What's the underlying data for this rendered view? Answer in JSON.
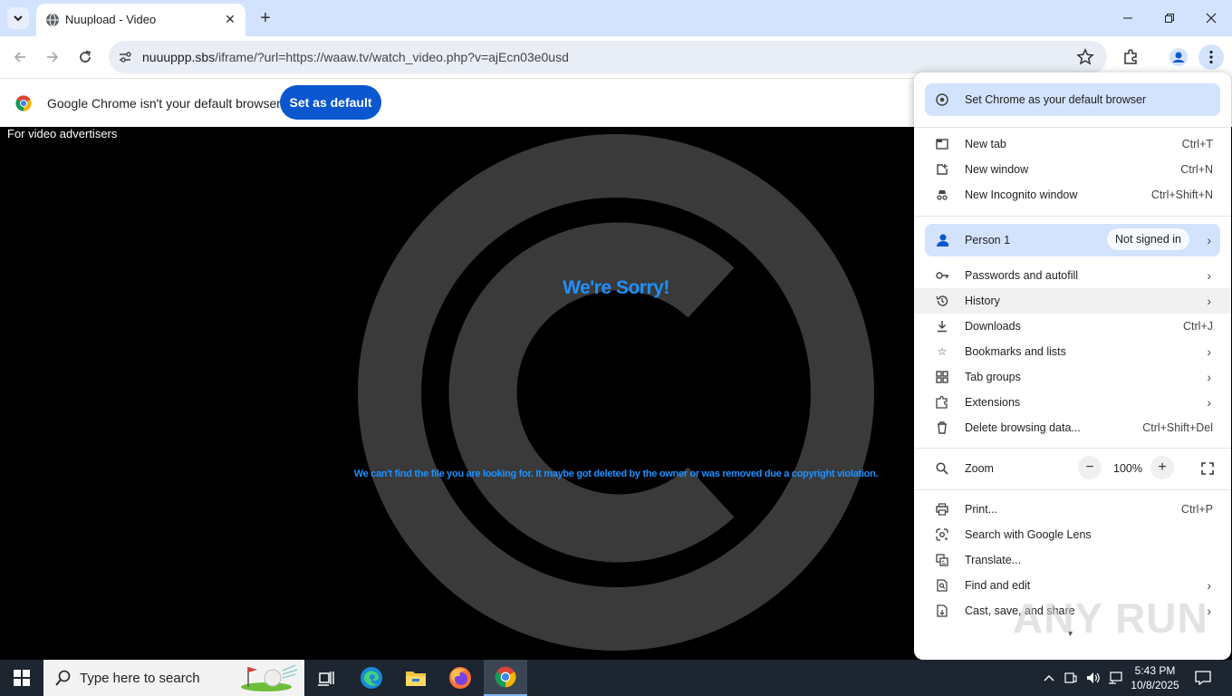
{
  "browser": {
    "tab_title": "Nuupload - Video",
    "url_domain": "nuuuppp.sbs",
    "url_path": "/iframe/?url=https://waaw.tv/watch_video.php?v=ajEcn03e0usd"
  },
  "infobar": {
    "message": "Google Chrome isn't your default browser",
    "button_label": "Set as default"
  },
  "page": {
    "advertisers_text": "For video advertisers",
    "heading": "We're Sorry!",
    "message": "We can't find the file you are looking for. It maybe got deleted by the owner or was removed due a copyright violation."
  },
  "menu": {
    "set_default": "Set Chrome as your default browser",
    "new_tab": {
      "label": "New tab",
      "shortcut": "Ctrl+T"
    },
    "new_window": {
      "label": "New window",
      "shortcut": "Ctrl+N"
    },
    "new_incognito": {
      "label": "New Incognito window",
      "shortcut": "Ctrl+Shift+N"
    },
    "profile": {
      "label": "Person 1",
      "status": "Not signed in"
    },
    "passwords": {
      "label": "Passwords and autofill"
    },
    "history": {
      "label": "History"
    },
    "downloads": {
      "label": "Downloads",
      "shortcut": "Ctrl+J"
    },
    "bookmarks": {
      "label": "Bookmarks and lists"
    },
    "tab_groups": {
      "label": "Tab groups"
    },
    "extensions": {
      "label": "Extensions"
    },
    "delete_data": {
      "label": "Delete browsing data...",
      "shortcut": "Ctrl+Shift+Del"
    },
    "zoom": {
      "label": "Zoom",
      "value": "100%",
      "minus": "−",
      "plus": "+"
    },
    "print": {
      "label": "Print...",
      "shortcut": "Ctrl+P"
    },
    "lens": {
      "label": "Search with Google Lens"
    },
    "translate": {
      "label": "Translate..."
    },
    "find_edit": {
      "label": "Find and edit"
    },
    "cast_save": {
      "label": "Cast, save, and share"
    }
  },
  "taskbar": {
    "search_placeholder": "Type here to search",
    "time": "5:43 PM",
    "date": "10/8/2025"
  },
  "watermark": "ANY RUN",
  "colors": {
    "chrome_frame": "#d3e3fd",
    "accent_blue": "#0b57d0",
    "page_text_blue": "#1e90ff",
    "copyright_gray": "#3a3a3a"
  }
}
